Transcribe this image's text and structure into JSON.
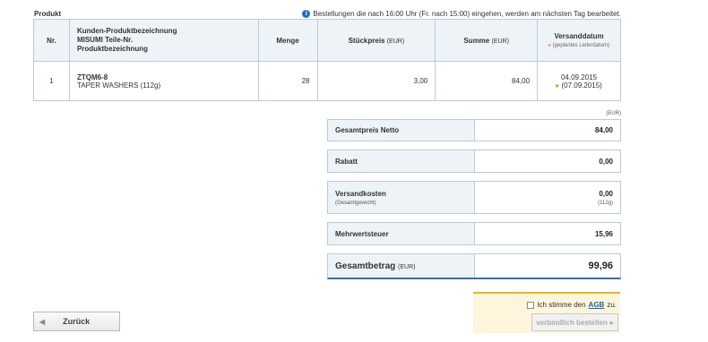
{
  "section_title": "Produkt",
  "notice": {
    "icon": "info-icon",
    "text": "Bestellungen die nach 16:00 Uhr (Fr. nach 15:00) eingehen, werden am nächsten Tag bearbeitet."
  },
  "table": {
    "headers": {
      "nr": "Nr.",
      "description_line1": "Kunden-Produktbezeichnung",
      "description_line2": "MISUMI Teile-Nr.",
      "description_line3": "Produktbezeichnung",
      "quantity": "Menge",
      "unit_price": "Stückpreis",
      "unit_price_unit": "(EUR)",
      "sum": "Summe",
      "sum_unit": "(EUR)",
      "ship_date": "Versanddatum",
      "ship_date_sub": "(geplantes Lieferdatum)"
    },
    "rows": [
      {
        "nr": "1",
        "part_no": "ZTQM6-8",
        "name": "TAPER WASHERS",
        "weight": "(112g)",
        "quantity": "28",
        "unit_price": "3,00",
        "sum": "84,00",
        "ship_date": "04.09.2015",
        "delivery_date": "(07.09.2015)"
      }
    ]
  },
  "summary": {
    "currency_label": "(EUR)",
    "net_label": "Gesamtpreis Netto",
    "net_value": "84,00",
    "discount_label": "Rabatt",
    "discount_value": "0,00",
    "shipping_label": "Versandkosten",
    "shipping_sub": "(Gesamtgewicht)",
    "shipping_value": "0,00",
    "shipping_weight": "(112g)",
    "vat_label": "Mehrwertsteuer",
    "vat_value": "15,96",
    "total_label": "Gesamtbetrag",
    "total_unit": "(EUR)",
    "total_value": "99,96"
  },
  "agb": {
    "prefix": "Ich stimme den",
    "link": "AGB",
    "suffix": "zu.",
    "checked": false
  },
  "buttons": {
    "submit": "verbindlich bestellen",
    "back": "Zurück"
  },
  "colors": {
    "header_bg": "#eef3f8",
    "border": "#b9cbd9",
    "accent_blue": "#2b71b8",
    "accent_orange": "#e38a13",
    "agb_bg": "#fdf6dc"
  }
}
